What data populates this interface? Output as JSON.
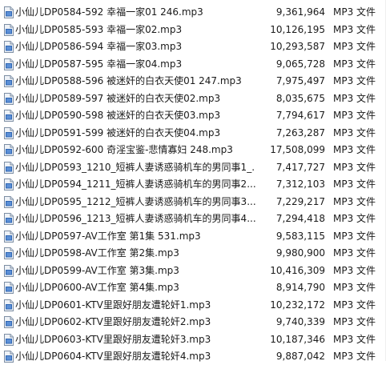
{
  "files": [
    {
      "name": "小仙儿DP0584-592 幸福一家01 246.mp3",
      "size": "9,361,964",
      "type": "MP3 文件",
      "icon": "mp3-file-icon"
    },
    {
      "name": "小仙儿DP0585-593 幸福一家02.mp3",
      "size": "10,126,195",
      "type": "MP3 文件",
      "icon": "mp3-file-icon"
    },
    {
      "name": "小仙儿DP0586-594 幸福一家03.mp3",
      "size": "10,293,587",
      "type": "MP3 文件",
      "icon": "mp3-file-icon"
    },
    {
      "name": "小仙儿DP0587-595 幸福一家04.mp3",
      "size": "9,065,728",
      "type": "MP3 文件",
      "icon": "mp3-file-icon"
    },
    {
      "name": "小仙儿DP0588-596 被迷奸的白衣天使01 247.mp3",
      "size": "7,975,497",
      "type": "MP3 文件",
      "icon": "mp3-file-icon"
    },
    {
      "name": "小仙儿DP0589-597 被迷奸的白衣天使02.mp3",
      "size": "8,035,675",
      "type": "MP3 文件",
      "icon": "mp3-file-icon"
    },
    {
      "name": "小仙儿DP0590-598 被迷奸的白衣天使03.mp3",
      "size": "7,794,617",
      "type": "MP3 文件",
      "icon": "mp3-file-icon"
    },
    {
      "name": "小仙儿DP0591-599 被迷奸的白衣天使04.mp3",
      "size": "7,263,287",
      "type": "MP3 文件",
      "icon": "mp3-file-icon"
    },
    {
      "name": "小仙儿DP0592-600 奇淫宝鉴-悲情寡妇 248.mp3",
      "size": "17,508,099",
      "type": "MP3 文件",
      "icon": "mp3-file-icon"
    },
    {
      "name": "小仙儿DP0593_1210_短裤人妻诱惑骑机车的男同事1_...",
      "size": "7,417,727",
      "type": "MP3 文件",
      "icon": "mp3-file-icon"
    },
    {
      "name": "小仙儿DP0594_1211_短裤人妻诱惑骑机车的男同事2....",
      "size": "7,312,103",
      "type": "MP3 文件",
      "icon": "mp3-file-icon"
    },
    {
      "name": "小仙儿DP0595_1212_短裤人妻诱惑骑机车的男同事3....",
      "size": "7,229,217",
      "type": "MP3 文件",
      "icon": "mp3-file-icon"
    },
    {
      "name": "小仙儿DP0596_1213_短裤人妻诱惑骑机车的男同事4....",
      "size": "7,294,418",
      "type": "MP3 文件",
      "icon": "mp3-file-icon"
    },
    {
      "name": "小仙儿DP0597-AV工作室 第1集 531.mp3",
      "size": "9,583,115",
      "type": "MP3 文件",
      "icon": "mp3-file-icon"
    },
    {
      "name": "小仙儿DP0598-AV工作室 第2集.mp3",
      "size": "9,980,900",
      "type": "MP3 文件",
      "icon": "mp3-file-icon"
    },
    {
      "name": "小仙儿DP0599-AV工作室 第3集.mp3",
      "size": "10,416,309",
      "type": "MP3 文件",
      "icon": "mp3-file-icon"
    },
    {
      "name": "小仙儿DP0600-AV工作室 第4集.mp3",
      "size": "8,914,790",
      "type": "MP3 文件",
      "icon": "mp3-file-icon"
    },
    {
      "name": "小仙儿DP0601-KTV里跟好朋友遭轮奸1.mp3",
      "size": "10,232,172",
      "type": "MP3 文件",
      "icon": "mp3-file-icon"
    },
    {
      "name": "小仙儿DP0602-KTV里跟好朋友遭轮奸2.mp3",
      "size": "9,740,339",
      "type": "MP3 文件",
      "icon": "mp3-file-icon"
    },
    {
      "name": "小仙儿DP0603-KTV里跟好朋友遭轮奸3.mp3",
      "size": "10,187,346",
      "type": "MP3 文件",
      "icon": "mp3-file-icon"
    },
    {
      "name": "小仙儿DP0604-KTV里跟好朋友遭轮奸4.mp3",
      "size": "9,887,042",
      "type": "MP3 文件",
      "icon": "mp3-file-icon"
    }
  ]
}
